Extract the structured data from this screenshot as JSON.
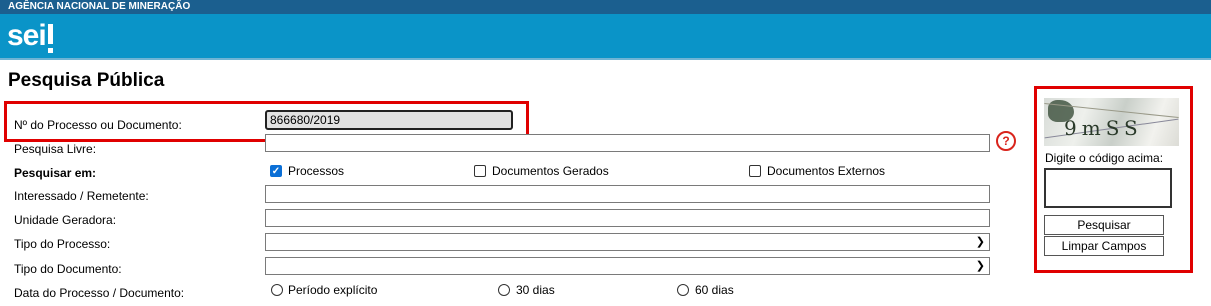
{
  "header": {
    "agency": "AGÊNCIA NACIONAL DE MINERAÇÃO",
    "logo": "sei"
  },
  "page_title": "Pesquisa Pública",
  "form": {
    "process_number_label": "Nº do Processo ou Documento:",
    "process_number_value": "866680/2019",
    "free_search_label": "Pesquisa Livre:",
    "help_icon": "question-circle-icon",
    "search_in_label": "Pesquisar em:",
    "search_in_options": [
      {
        "label": "Processos",
        "checked": true
      },
      {
        "label": "Documentos Gerados",
        "checked": false
      },
      {
        "label": "Documentos Externos",
        "checked": false
      }
    ],
    "interested_label": "Interessado / Remetente:",
    "unit_label": "Unidade Geradora:",
    "process_type_label": "Tipo do Processo:",
    "document_type_label": "Tipo do Documento:",
    "date_label": "Data do Processo / Documento:",
    "date_options": [
      "Período explícito",
      "30 dias",
      "60 dias"
    ]
  },
  "captcha": {
    "code_text": "9mSS",
    "prompt": "Digite o código acima:",
    "search_button": "Pesquisar",
    "clear_button": "Limpar Campos"
  },
  "colors": {
    "topbar": "#1b5f8f",
    "header": "#0a94c8",
    "highlight": "#e00000",
    "checkbox_checked": "#0b6fd6"
  }
}
